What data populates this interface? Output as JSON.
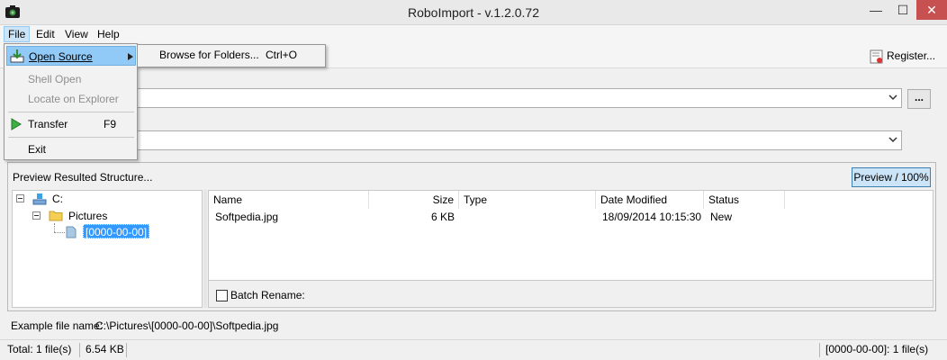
{
  "window": {
    "title": "RoboImport - v.1.2.0.72",
    "minimize": "—",
    "maximize": "☐",
    "close": "✕"
  },
  "menubar": {
    "file": "File",
    "edit": "Edit",
    "view": "View",
    "help": "Help"
  },
  "file_menu": {
    "open_source": "Open Source",
    "shell_open": "Shell Open",
    "locate_on_explorer": "Locate on Explorer",
    "transfer": "Transfer",
    "transfer_shortcut": "F9",
    "exit": "Exit"
  },
  "submenu": {
    "browse_for_folders": "Browse for Folders...",
    "shortcut": "Ctrl+O"
  },
  "toolbar": {
    "register_label": "Register..."
  },
  "browse_button": "...",
  "preview": {
    "header_label": "Preview Resulted Structure...",
    "toggle_label": "Preview / 100%"
  },
  "tree": {
    "root": "C:",
    "folder": "Pictures",
    "subfolder": "[0000-00-00]"
  },
  "file_list": {
    "columns": [
      "Name",
      "Size",
      "Type",
      "Date Modified",
      "Status"
    ],
    "rows": [
      {
        "name": "Softpedia.jpg",
        "size": "6 KB",
        "type": "",
        "date": "18/09/2014 10:15:30",
        "status": "New"
      }
    ]
  },
  "batch_rename": {
    "label": "Batch Rename:",
    "checked": false
  },
  "example": {
    "label": "Example file name:",
    "value": "C:\\Pictures\\[0000-00-00]\\Softpedia.jpg"
  },
  "statusbar": {
    "total": "Total: 1 file(s)",
    "size": "6.54 KB",
    "right": "[0000-00-00]: 1 file(s)"
  },
  "colors": {
    "selection": "#3399ff",
    "menu_highlight": "#91c9f7",
    "toggle_bg": "#cce4f7",
    "close_button": "#c75050"
  }
}
